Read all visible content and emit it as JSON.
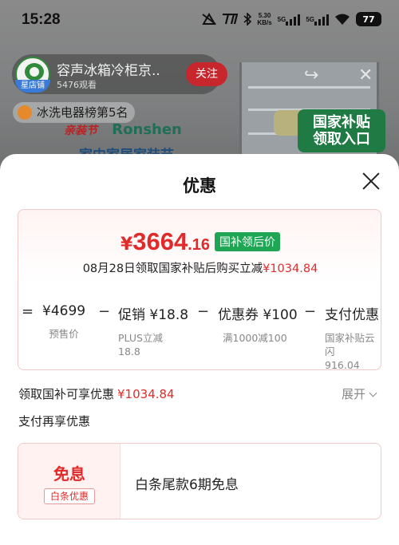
{
  "status_bar": {
    "time": "15:28",
    "speed_value": "5.30",
    "speed_unit": "KB/s",
    "net1": "5G",
    "net2": "5G",
    "battery": "77"
  },
  "background": {
    "shop_name": "容声冰箱冷柜京..",
    "shop_badge": "星店铺",
    "shop_views": "5476观看",
    "follow_label": "关注",
    "rank_label": "冰洗电器榜第5名",
    "brand_tag": "亲装节",
    "brand_name": "Ronshen",
    "brand_sub": "家中家居家装节",
    "subsidy_entry_line1": "国家补贴",
    "subsidy_entry_line2": "领取入口"
  },
  "sheet": {
    "title": "优惠",
    "final_price": {
      "currency": "¥",
      "integer": "3664",
      "decimal": ".16",
      "tag": "国补领后价"
    },
    "note_prefix": "08月28日领取国家补贴后购买立减",
    "note_amount": "¥1034.84",
    "breakdown": [
      {
        "op": "=",
        "main": "¥4699",
        "sub": "预售价"
      },
      {
        "op": "−",
        "main": "促销 ¥18.8",
        "sub": "PLUS立减\n18.8"
      },
      {
        "op": "−",
        "main": "优惠券 ¥100",
        "sub": "满1000减100"
      },
      {
        "op": "−",
        "main": "支付优惠",
        "sub": "国家补贴云闪\n916.04"
      }
    ],
    "subsidy_row_label": "领取国补可享优惠",
    "subsidy_row_amount": "¥1034.84",
    "expand_label": "展开",
    "pay_row_label": "支付再享优惠",
    "pay_card": {
      "main": "免息",
      "tag": "白条优惠",
      "desc": "白条尾款6期免息"
    }
  }
}
